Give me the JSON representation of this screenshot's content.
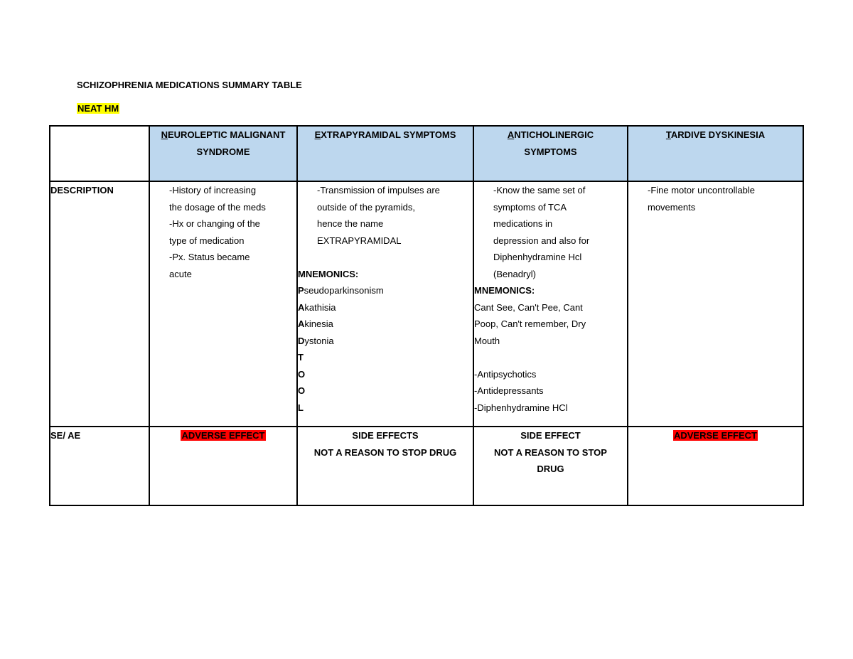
{
  "document": {
    "title": "SCHIZOPHRENIA MEDICATIONS SUMMARY TABLE",
    "subtitle": "NEAT HM",
    "subtitle_highlight": "#ffff00",
    "header_fill": "#bdd7ee",
    "adverse_highlight": "#ff0000"
  },
  "table": {
    "headers": [
      {
        "initial": "N",
        "rest_line1": "EUROLEPTIC MALIGNANT",
        "line2": "SYNDROME"
      },
      {
        "initial": "E",
        "rest_line1": "XTRAPYRAMIDAL SYMPTOMS",
        "line2": ""
      },
      {
        "initial": "A",
        "rest_line1": "NTICHOLINERGIC",
        "line2": "SYMPTOMS"
      },
      {
        "initial": "T",
        "rest_line1": "ARDIVE DYSKINESIA",
        "line2": ""
      }
    ],
    "rows": {
      "description": {
        "label": "DESCRIPTION",
        "nms": {
          "lines": [
            "-History of increasing",
            "the dosage of the meds",
            "-Hx or changing of the",
            "type of medication",
            "-Px. Status became",
            "acute"
          ]
        },
        "eps": {
          "intro": [
            "-Transmission of impulses are",
            "outside of the pyramids,",
            "hence the name",
            "EXTRAPYRAMIDAL"
          ],
          "mnemonics_label": "MNEMONICS:",
          "mnemonics": [
            {
              "first": "P",
              "rest": "seudoparkinsonism"
            },
            {
              "first": "A",
              "rest": "kathisia"
            },
            {
              "first": "A",
              "rest": "kinesia"
            },
            {
              "first": "D",
              "rest": "ystonia"
            },
            {
              "first": "T",
              "rest": ""
            },
            {
              "first": "O",
              "rest": ""
            },
            {
              "first": "O",
              "rest": ""
            },
            {
              "first": "L",
              "rest": ""
            }
          ]
        },
        "anticholinergic": {
          "intro": [
            "-Know the same set of",
            "symptoms of TCA",
            "medications in",
            "depression and also for",
            "Diphenhydramine Hcl",
            "(Benadryl)"
          ],
          "mnemonics_label": "MNEMONICS:",
          "mnemonics_lines": [
            "Cant See, Can't Pee, Cant",
            "Poop, Can't remember, Dry",
            "Mouth"
          ],
          "drug_classes": [
            "-Antipsychotics",
            "-Antidepressants",
            "-Diphenhydramine HCl"
          ]
        },
        "td": {
          "lines": [
            "-Fine motor uncontrollable",
            "movements"
          ]
        }
      },
      "se_ae": {
        "label": "SE/ AE",
        "nms": {
          "badge": "ADVERSE EFFECT"
        },
        "eps": {
          "lines": [
            "SIDE EFFECTS",
            "NOT A REASON TO STOP DRUG"
          ]
        },
        "anticholinergic": {
          "lines": [
            "SIDE EFFECT",
            "NOT A REASON TO STOP",
            "DRUG"
          ]
        },
        "td": {
          "badge": "ADVERSE EFFECT"
        }
      }
    }
  }
}
